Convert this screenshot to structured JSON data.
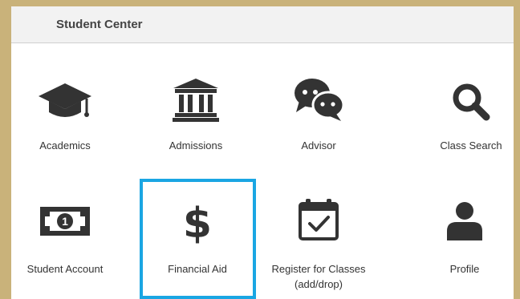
{
  "header": {
    "title": "Student Center"
  },
  "tiles": [
    {
      "label": "Academics",
      "icon": "graduation-cap-icon"
    },
    {
      "label": "Admissions",
      "icon": "institution-icon"
    },
    {
      "label": "Advisor",
      "icon": "chat-bubbles-icon"
    },
    {
      "label": "Class Search",
      "icon": "search-icon"
    },
    {
      "label": "Student Account",
      "icon": "money-bill-icon"
    },
    {
      "label": "Financial Aid",
      "icon": "dollar-icon"
    },
    {
      "label": "Register for Classes\n(add/drop)",
      "icon": "calendar-check-icon"
    },
    {
      "label": "Profile",
      "icon": "user-icon"
    }
  ],
  "colors": {
    "icon": "#333333",
    "highlight": "#1aa6e3",
    "background": "#c9b27a"
  }
}
